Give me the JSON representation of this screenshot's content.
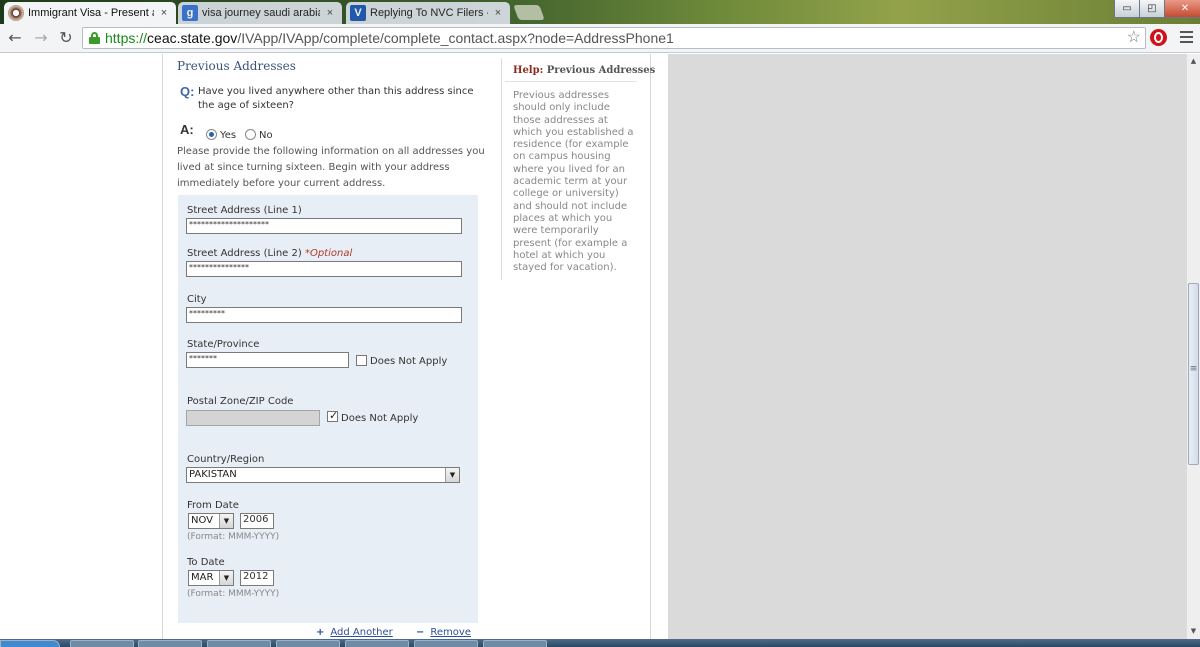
{
  "browser": {
    "tabs": [
      {
        "title": "Immigrant Visa - Present a",
        "favicon": "us-seal-icon",
        "active": true
      },
      {
        "title": "visa journey saudi arabia p",
        "favicon": "google-icon",
        "active": false
      },
      {
        "title": "Replying To NVC Filers - I",
        "favicon": "visajourney-icon",
        "active": false
      }
    ],
    "tab_close_glyph": "×",
    "google_glyph": "g",
    "vj_glyph": "V",
    "window_controls": {
      "minimize": "▭",
      "maximize": "◰",
      "close": "✕"
    },
    "nav": {
      "back": "←",
      "forward": "→",
      "reload": "↻"
    },
    "url": {
      "scheme": "https://",
      "host": "ceac.state.gov",
      "path": "/IVApp/IVApp/complete/complete_contact.aspx?node=AddressPhone1"
    },
    "bookmark_star": "☆"
  },
  "form": {
    "section_title": "Previous Addresses",
    "question_label": "Q:",
    "question_text": "Have you lived anywhere other than this address since the age of sixteen?",
    "answer_label": "A:",
    "answer_yes": "Yes",
    "answer_no": "No",
    "instructions": "Please provide the following information on all addresses you lived at since turning sixteen. Begin with your address immediately before your current address.",
    "street1_label": "Street Address (Line 1)",
    "street1_value": "********************",
    "street2_label": "Street Address (Line 2)",
    "street2_optional": "*Optional",
    "street2_value": "***************",
    "city_label": "City",
    "city_value": "*********",
    "state_label": "State/Province",
    "state_value": "*******",
    "state_dna_label": "Does Not Apply",
    "zip_label": "Postal Zone/ZIP Code",
    "zip_dna_label": "Does Not Apply",
    "country_label": "Country/Region",
    "country_value": "PAKISTAN",
    "from_label": "From Date",
    "from_month": "NOV",
    "from_year": "2006",
    "from_format": "(Format: MMM-YYYY)",
    "to_label": "To Date",
    "to_month": "MAR",
    "to_year": "2012",
    "to_format": "(Format: MMM-YYYY)",
    "add_icon": "+",
    "add_label": "Add Another",
    "remove_icon": "−",
    "remove_label": "Remove",
    "dropdown_arrow": "▼"
  },
  "help": {
    "title_prefix": "Help:",
    "title_topic": "Previous Addresses",
    "body": "Previous addresses should only include those addresses at which you established a residence (for example on campus housing where you lived for an academic term at your college or university) and should not include places at which you were temporarily present (for example a hotel at which you stayed for vacation)."
  },
  "scrollbar": {
    "up": "▲",
    "down": "▼",
    "grip": "≡"
  }
}
